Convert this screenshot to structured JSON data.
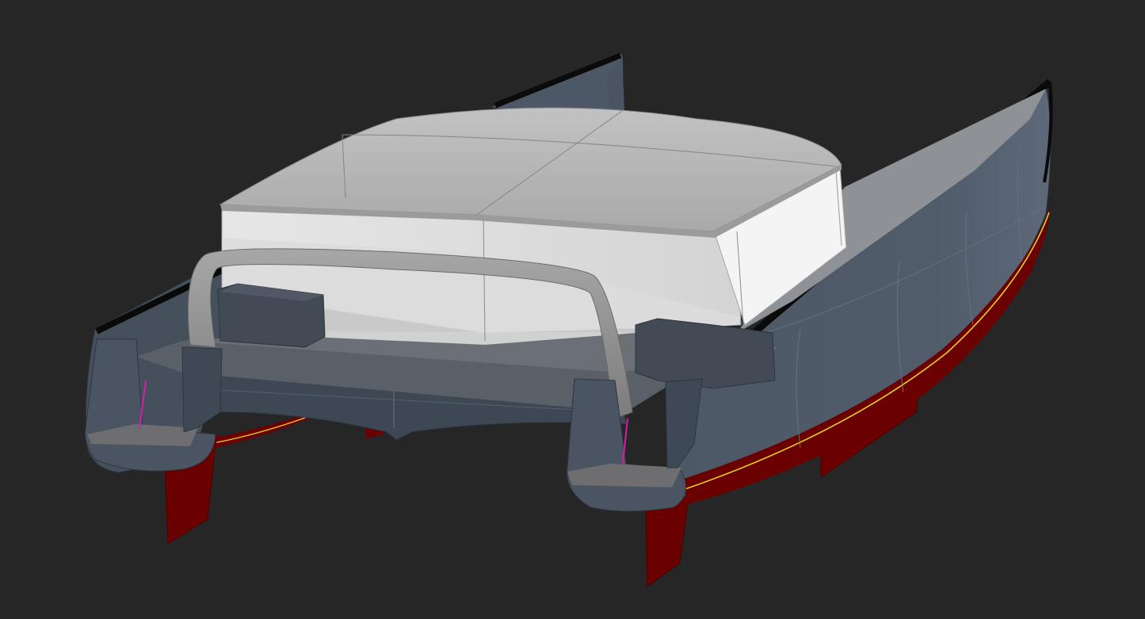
{
  "scene": {
    "subject": "catamaran-hull-3d-render",
    "colors": {
      "background": "#262626",
      "hull": "#4a5563",
      "hull_dark": "#3b4450",
      "hull_light": "#5a6676",
      "cabin_roof": "#b9b9b9",
      "cabin_wall": "#ededed",
      "deck": "#8d9196",
      "antifouling": "#6b0000",
      "waterline": "#e8d21a",
      "sheer": "#0a0a0a",
      "step": "#6f6f71"
    }
  }
}
